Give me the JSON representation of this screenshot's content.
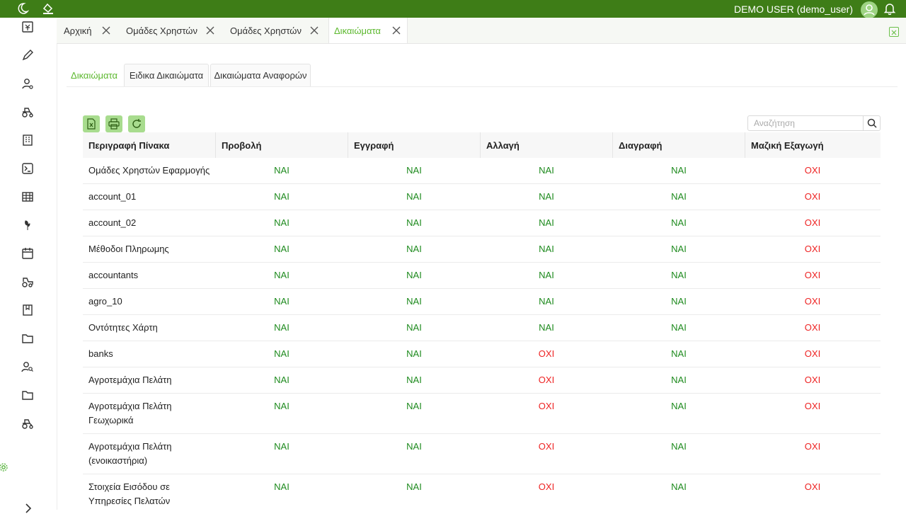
{
  "topbar": {
    "user_name": "DEMO USER (demo_user)"
  },
  "sidebar": {
    "icons": [
      "invoice-icon",
      "pen-icon",
      "user-settings-icon",
      "tractor-icon",
      "building-icon",
      "terminal-icon",
      "table-icon",
      "plant-icon",
      "calendar-icon",
      "tractor-trailer-icon",
      "book-icon",
      "folder-icon",
      "user-search-icon",
      "folder-icon",
      "tractor-icon"
    ],
    "settings_icon": "gear-icon",
    "expand_icon": "chevron-right-icon"
  },
  "tabs": [
    {
      "label": "Αρχική"
    },
    {
      "label": "Ομάδες Χρηστών"
    },
    {
      "label": "Ομάδες Χρηστών"
    },
    {
      "label": "Δικαιώματα"
    }
  ],
  "subtabs": [
    {
      "label": "Δικαιώματα"
    },
    {
      "label": "Ειδικα Δικαιώματα"
    },
    {
      "label": "Δικαιώματα Αναφορών"
    }
  ],
  "toolbar": {
    "excel_icon": "excel-export-icon",
    "print_icon": "print-icon",
    "refresh_icon": "refresh-icon"
  },
  "search": {
    "placeholder": "Αναζήτηση"
  },
  "table": {
    "headers": [
      "Περιγραφή Πίνακα",
      "Προβολή",
      "Εγγραφή",
      "Αλλαγή",
      "Διαγραφή",
      "Μαζική Εξαγωγή"
    ],
    "rows": [
      {
        "name": "Ομάδες Χρηστών Εφαρμογής",
        "values": [
          "ΝΑΙ",
          "ΝΑΙ",
          "ΝΑΙ",
          "ΝΑΙ",
          "ΟΧΙ"
        ]
      },
      {
        "name": "account_01",
        "values": [
          "ΝΑΙ",
          "ΝΑΙ",
          "ΝΑΙ",
          "ΝΑΙ",
          "ΟΧΙ"
        ]
      },
      {
        "name": "account_02",
        "values": [
          "ΝΑΙ",
          "ΝΑΙ",
          "ΝΑΙ",
          "ΝΑΙ",
          "ΟΧΙ"
        ]
      },
      {
        "name": "Μέθοδοι Πληρωμης",
        "values": [
          "ΝΑΙ",
          "ΝΑΙ",
          "ΝΑΙ",
          "ΝΑΙ",
          "ΟΧΙ"
        ]
      },
      {
        "name": "accountants",
        "values": [
          "ΝΑΙ",
          "ΝΑΙ",
          "ΝΑΙ",
          "ΝΑΙ",
          "ΟΧΙ"
        ]
      },
      {
        "name": "agro_10",
        "values": [
          "ΝΑΙ",
          "ΝΑΙ",
          "ΝΑΙ",
          "ΝΑΙ",
          "ΟΧΙ"
        ]
      },
      {
        "name": "Οντότητες Χάρτη",
        "values": [
          "ΝΑΙ",
          "ΝΑΙ",
          "ΝΑΙ",
          "ΝΑΙ",
          "ΟΧΙ"
        ]
      },
      {
        "name": "banks",
        "values": [
          "ΝΑΙ",
          "ΝΑΙ",
          "ΟΧΙ",
          "ΝΑΙ",
          "ΟΧΙ"
        ]
      },
      {
        "name": "Αγροτεμάχια Πελάτη",
        "values": [
          "ΝΑΙ",
          "ΝΑΙ",
          "ΟΧΙ",
          "ΝΑΙ",
          "ΟΧΙ"
        ]
      },
      {
        "name": "Αγροτεμάχια Πελάτη Γεωχωρικά",
        "values": [
          "ΝΑΙ",
          "ΝΑΙ",
          "ΟΧΙ",
          "ΝΑΙ",
          "ΟΧΙ"
        ]
      },
      {
        "name": "Αγροτεμάχια Πελάτη (ενοικαστήρια)",
        "values": [
          "ΝΑΙ",
          "ΝΑΙ",
          "ΟΧΙ",
          "ΝΑΙ",
          "ΟΧΙ"
        ]
      },
      {
        "name": "Στοιχεία Εισόδου σε Υπηρεσίες Πελατών",
        "values": [
          "ΝΑΙ",
          "ΝΑΙ",
          "ΟΧΙ",
          "ΝΑΙ",
          "ΟΧΙ"
        ]
      }
    ]
  },
  "colors": {
    "brand": "#3e7d17",
    "accent": "#5cb82e",
    "yes": "#1d8a1d",
    "no": "#ee2222"
  }
}
